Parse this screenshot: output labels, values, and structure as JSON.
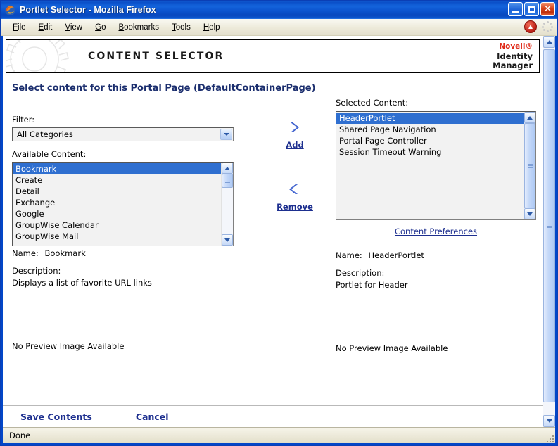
{
  "window": {
    "title": "Portlet Selector - Mozilla Firefox",
    "icon": "firefox-icon",
    "controls": {
      "minimize": "minimize-button",
      "maximize": "maximize-button",
      "close": "close-button"
    }
  },
  "menubar": {
    "items": [
      {
        "label": "File",
        "accel": "F"
      },
      {
        "label": "Edit",
        "accel": "E"
      },
      {
        "label": "View",
        "accel": "V"
      },
      {
        "label": "Go",
        "accel": "G"
      },
      {
        "label": "Bookmarks",
        "accel": "B"
      },
      {
        "label": "Tools",
        "accel": "T"
      },
      {
        "label": "Help",
        "accel": "H"
      }
    ],
    "right_icons": [
      "stop-icon",
      "throbber-icon"
    ]
  },
  "header": {
    "title": "CONTENT SELECTOR",
    "watermark": "gear-icon",
    "brand_line1": "Novell®",
    "brand_line2": "Identity",
    "brand_line3": "Manager",
    "brand_color": "#e02b19"
  },
  "page_title": "Select content for this Portal Page (DefaultContainerPage)",
  "left": {
    "filter_label": "Filter:",
    "filter_value": "All Categories",
    "filter_options": [
      "All Categories"
    ],
    "available_label": "Available Content:",
    "available_items": [
      "Bookmark",
      "Create",
      "Detail",
      "Exchange",
      "Google",
      "GroupWise Calendar",
      "GroupWise Mail"
    ],
    "available_selected_index": 0,
    "detail_name_label": "Name:",
    "detail_name_value": "Bookmark",
    "detail_desc_label": "Description:",
    "detail_desc_value": "Displays a list of favorite URL links",
    "preview_text": "No Preview Image Available"
  },
  "middle": {
    "add_label": "Add",
    "add_icon": "chevron-right-icon",
    "remove_label": "Remove",
    "remove_icon": "chevron-left-icon"
  },
  "right": {
    "selected_label": "Selected Content:",
    "selected_items": [
      "HeaderPortlet",
      "Shared Page Navigation",
      "Portal Page Controller",
      "Session Timeout Warning"
    ],
    "selected_selected_index": 0,
    "preferences_link": "Content Preferences",
    "detail_name_label": "Name:",
    "detail_name_value": "HeaderPortlet",
    "detail_desc_label": "Description:",
    "detail_desc_value": "Portlet for Header",
    "preview_text": "No Preview Image Available"
  },
  "actions": {
    "save_label": "Save Contents",
    "cancel_label": "Cancel"
  },
  "statusbar": {
    "text": "Done"
  },
  "colors": {
    "titlebar": "#0a4fc8",
    "selection": "#2f6fd0",
    "link": "#1d2f8f",
    "page_title": "#1b2e6e"
  }
}
